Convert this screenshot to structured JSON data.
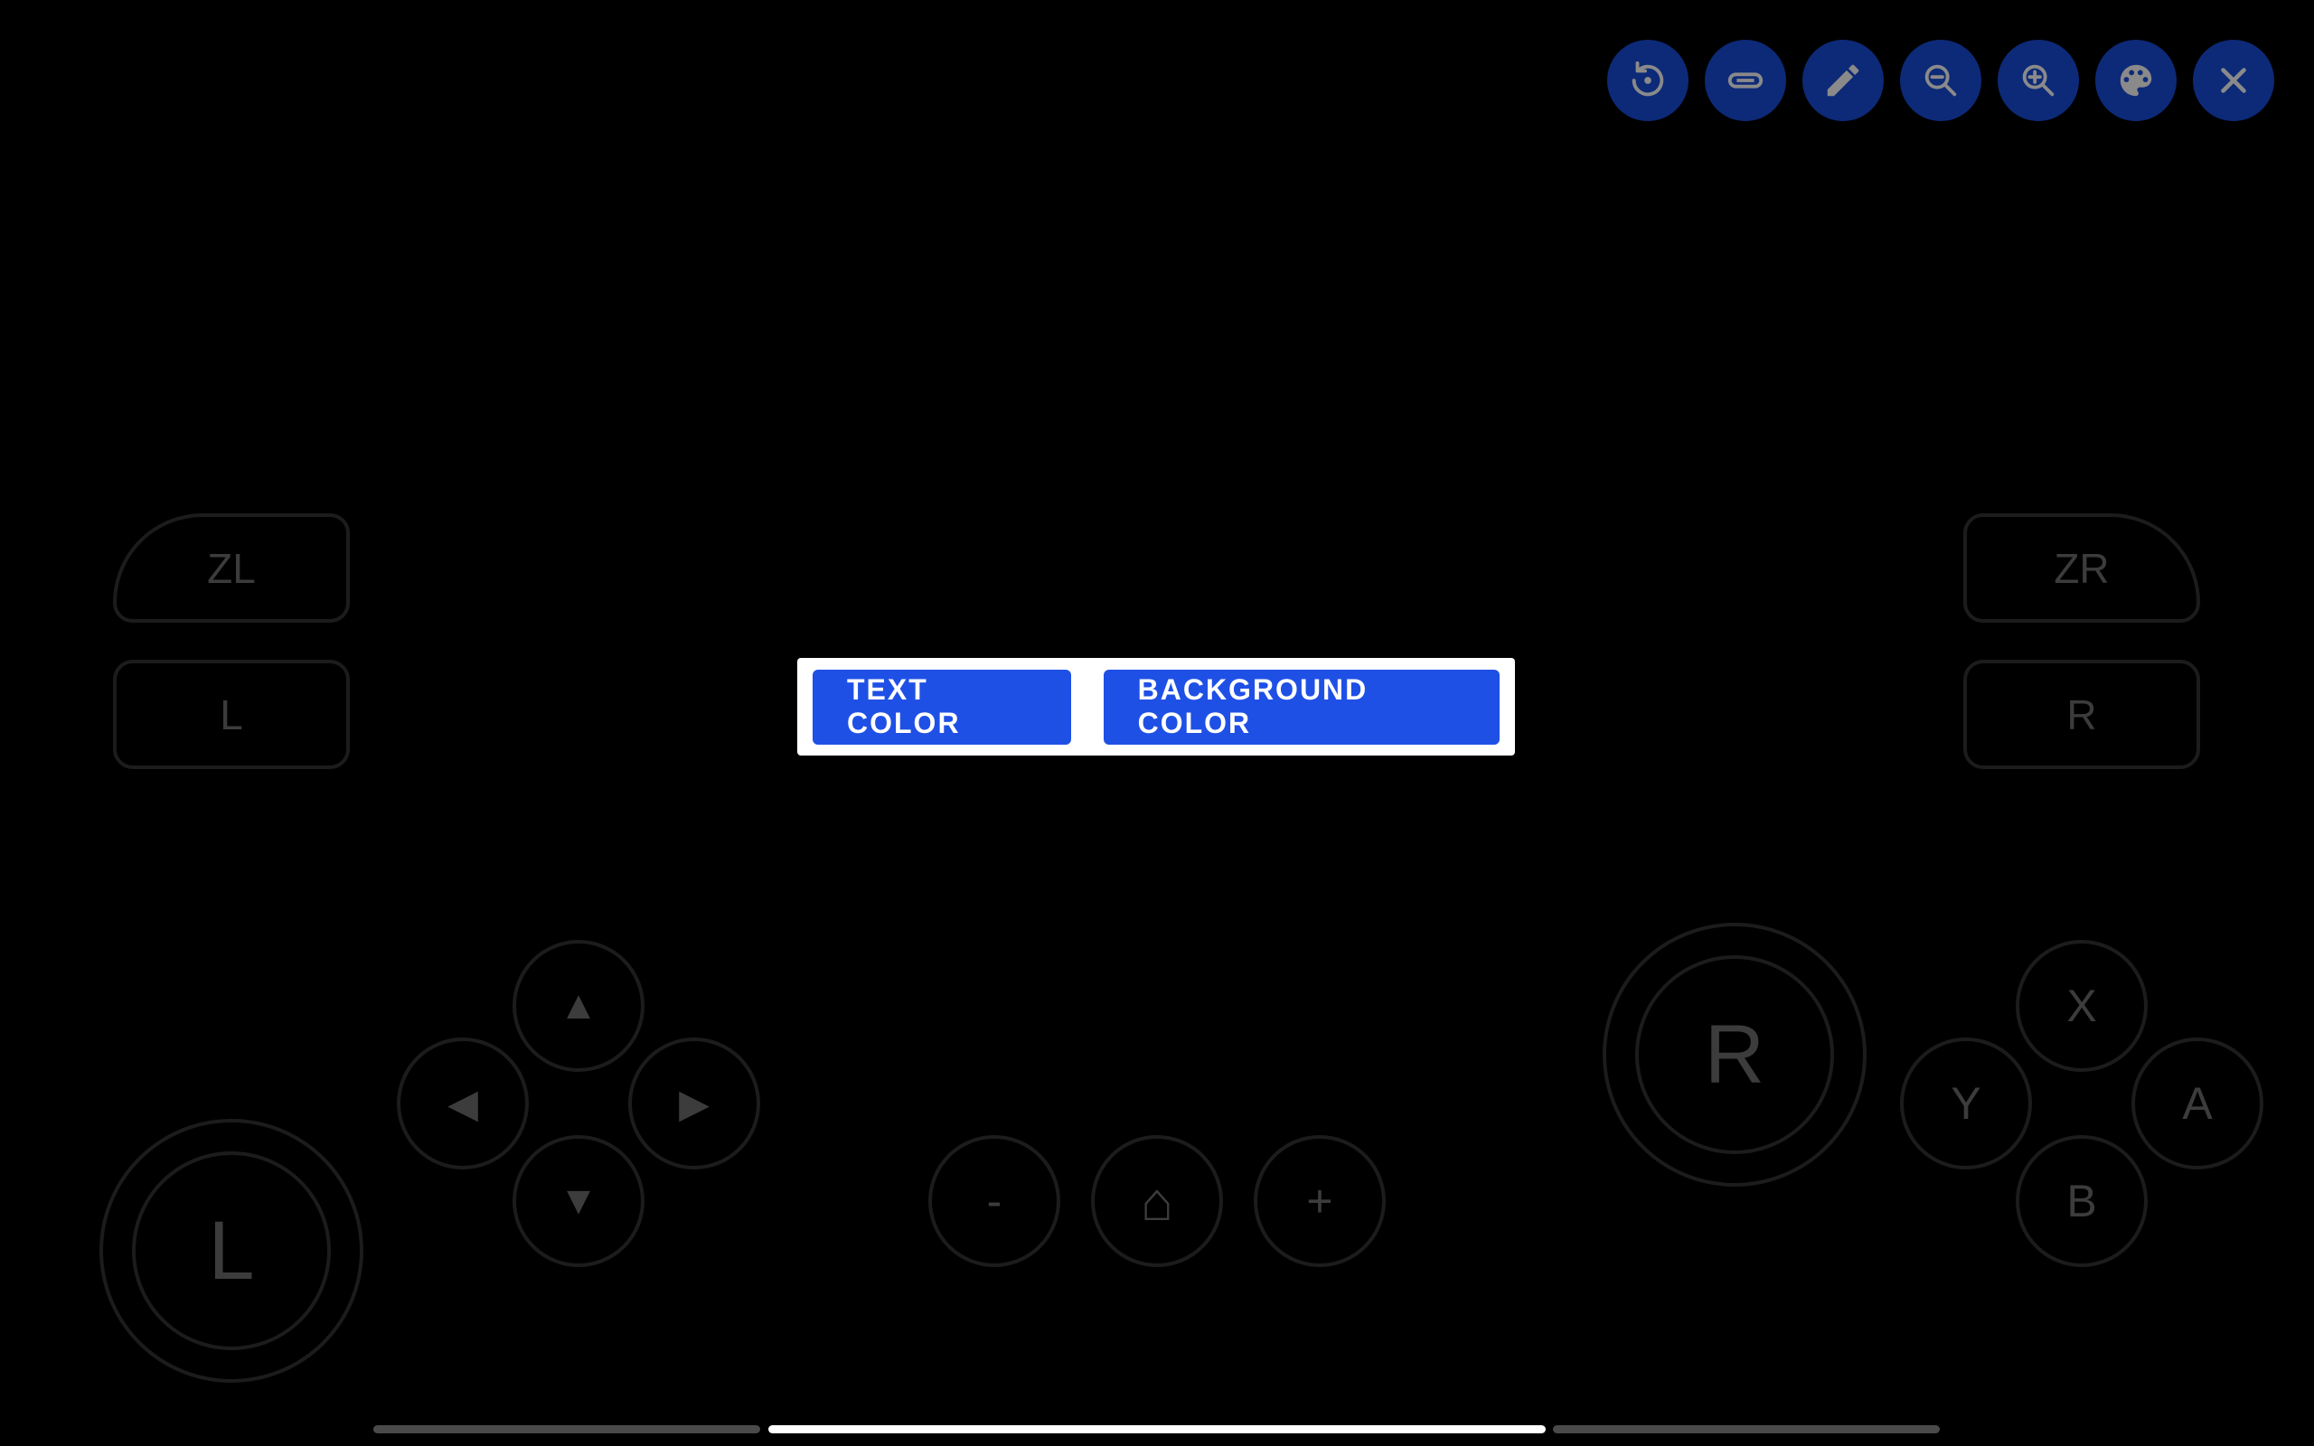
{
  "toolbar": {
    "buttons": [
      {
        "name": "reset-icon"
      },
      {
        "name": "toggle-controls-icon"
      },
      {
        "name": "edit-icon"
      },
      {
        "name": "zoom-out-icon"
      },
      {
        "name": "zoom-in-icon"
      },
      {
        "name": "palette-icon"
      },
      {
        "name": "close-icon"
      }
    ],
    "button_bg": "#0d2a78",
    "icon_color": "#8a8a8a"
  },
  "dialog": {
    "text_color_label": "TEXT COLOR",
    "background_color_label": "BACKGROUND COLOR",
    "accent": "#1f50e6"
  },
  "controller": {
    "zl_label": "ZL",
    "l_label": "L",
    "zr_label": "ZR",
    "r_label": "R",
    "left_stick_label": "L",
    "right_stick_label": "R",
    "dpad_up": "▲",
    "dpad_left": "◀",
    "dpad_right": "▶",
    "dpad_down": "▼",
    "minus_label": "-",
    "home_label": "⌂",
    "plus_label": "+",
    "x_label": "X",
    "y_label": "Y",
    "a_label": "A",
    "b_label": "B"
  }
}
